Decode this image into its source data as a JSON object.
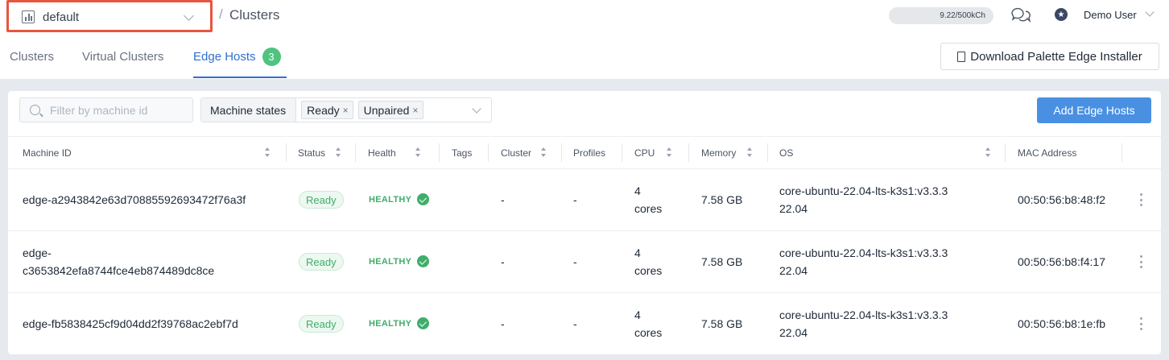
{
  "header": {
    "project": "default",
    "breadcrumb_sep": "/",
    "breadcrumb": "Clusters",
    "usage": "9.22/500kCh",
    "user_name": "Demo User"
  },
  "tabs": [
    {
      "label": "Clusters",
      "active": false
    },
    {
      "label": "Virtual Clusters",
      "active": false
    },
    {
      "label": "Edge Hosts",
      "active": true,
      "badge": "3"
    }
  ],
  "toolbar": {
    "download_label": "Download Palette Edge Installer",
    "filter_placeholder": "Filter by machine id",
    "states_label": "Machine states",
    "chips": [
      "Ready",
      "Unpaired"
    ],
    "chip_remove": "×",
    "add_label": "Add Edge Hosts"
  },
  "table": {
    "columns": [
      "Machine ID",
      "Status",
      "Health",
      "Tags",
      "Cluster",
      "Profiles",
      "CPU",
      "Memory",
      "OS",
      "MAC Address"
    ],
    "rows": [
      {
        "machine_id": [
          "edge-a2943842e63d70885592693472f76a3f"
        ],
        "status": "Ready",
        "health": "HEALTHY",
        "cluster": "-",
        "profiles": "-",
        "cpu": [
          "4",
          "cores"
        ],
        "memory": "7.58 GB",
        "os": [
          "core-ubuntu-22.04-lts-k3s1:v3.3.3",
          "22.04"
        ],
        "mac": "00:50:56:b8:48:f2"
      },
      {
        "machine_id": [
          "edge-",
          "c3653842efa8744fce4eb874489dc8ce"
        ],
        "status": "Ready",
        "health": "HEALTHY",
        "cluster": "-",
        "profiles": "-",
        "cpu": [
          "4",
          "cores"
        ],
        "memory": "7.58 GB",
        "os": [
          "core-ubuntu-22.04-lts-k3s1:v3.3.3",
          "22.04"
        ],
        "mac": "00:50:56:b8:f4:17"
      },
      {
        "machine_id": [
          "edge-fb5838425cf9d04dd2f39768ac2ebf7d"
        ],
        "status": "Ready",
        "health": "HEALTHY",
        "cluster": "-",
        "profiles": "-",
        "cpu": [
          "4",
          "cores"
        ],
        "memory": "7.58 GB",
        "os": [
          "core-ubuntu-22.04-lts-k3s1:v3.3.3",
          "22.04"
        ],
        "mac": "00:50:56:b8:1e:fb"
      }
    ]
  },
  "colors": {
    "accent": "#2f6fcf",
    "primary_button": "#4a90e2",
    "healthy": "#3fae6a",
    "highlight_border": "#e8553e"
  }
}
